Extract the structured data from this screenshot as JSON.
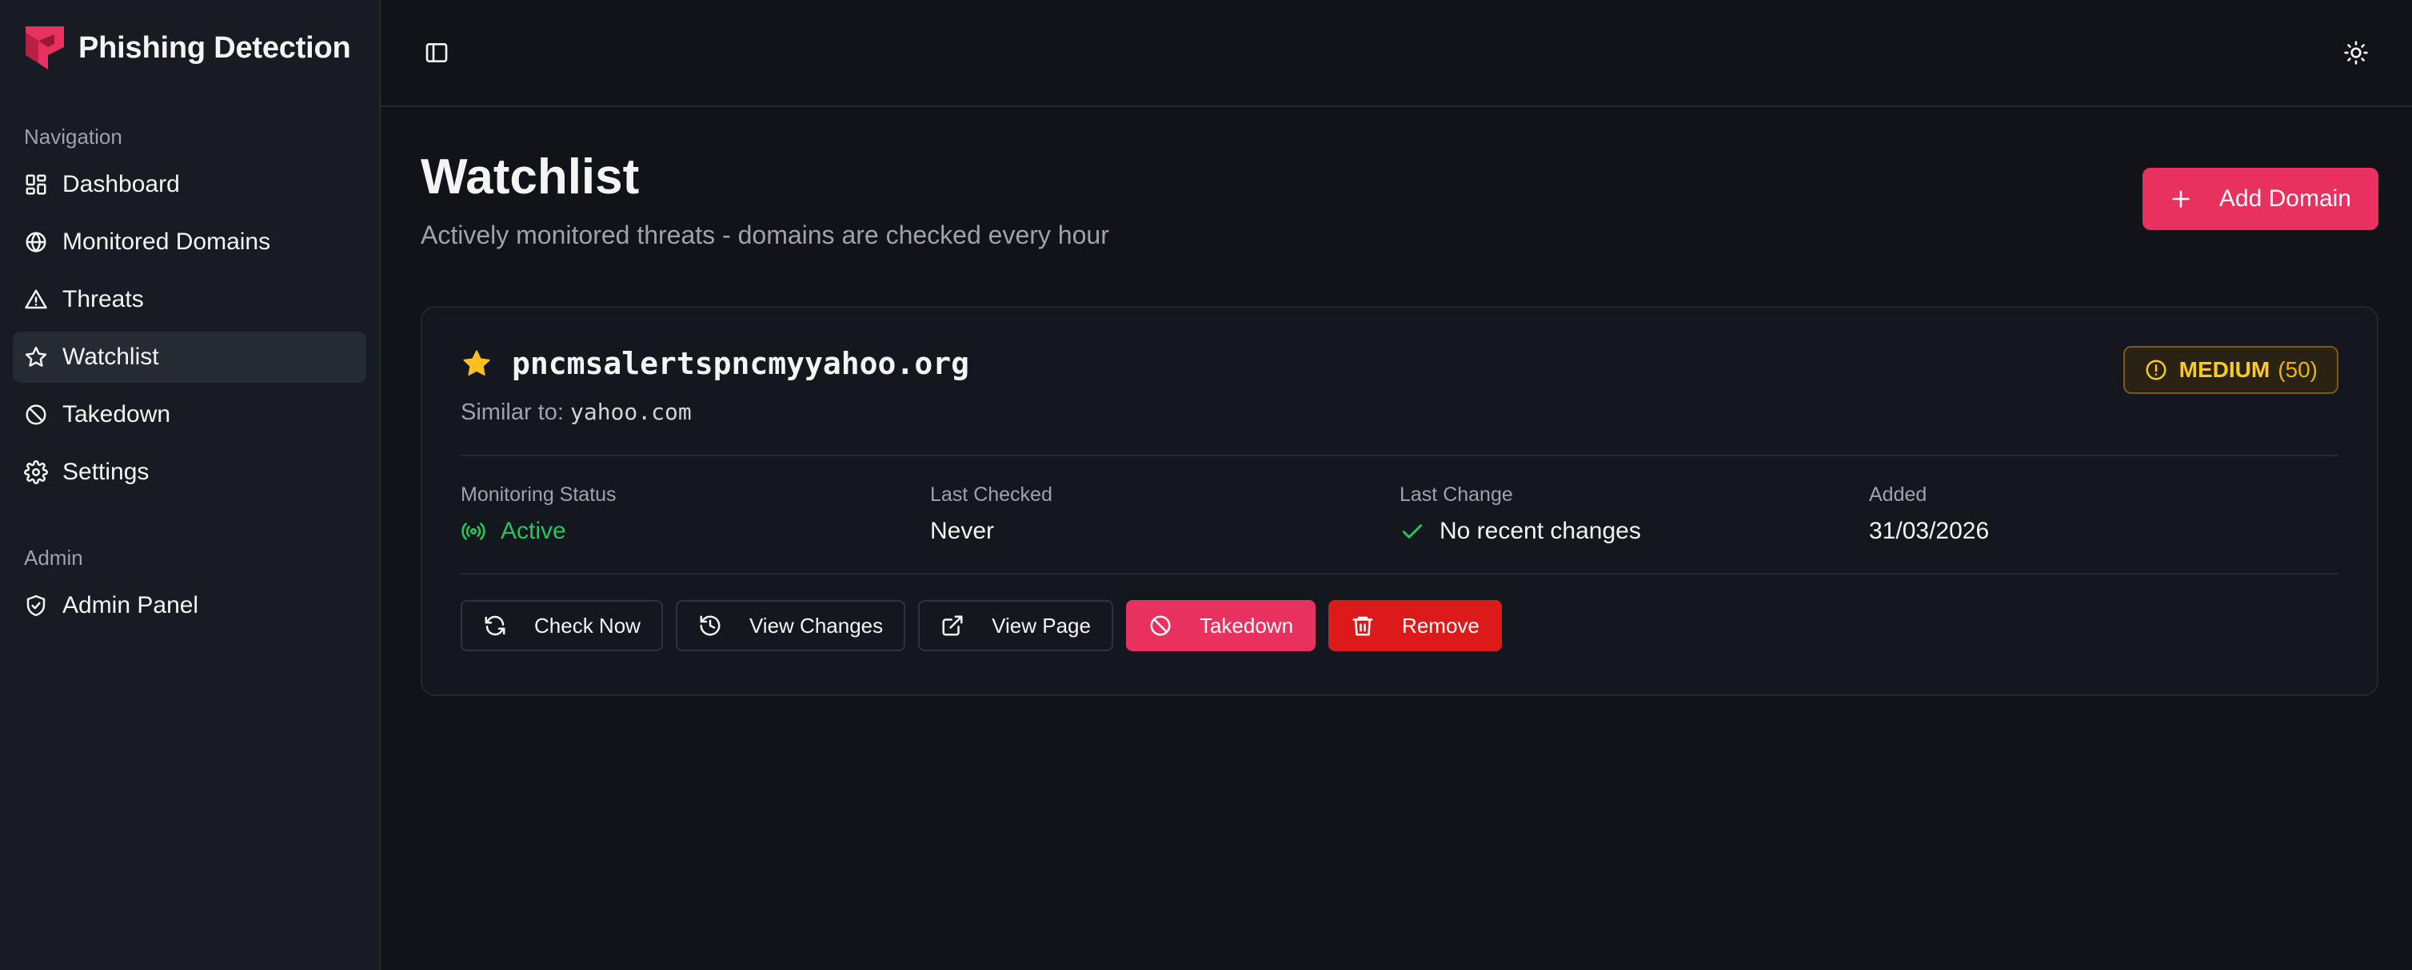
{
  "app": {
    "title": "Phishing Detection"
  },
  "sidebar": {
    "nav_label": "Navigation",
    "items": [
      {
        "label": "Dashboard",
        "icon": "dashboard-icon"
      },
      {
        "label": "Monitored Domains",
        "icon": "globe-icon"
      },
      {
        "label": "Threats",
        "icon": "alert-triangle-icon"
      },
      {
        "label": "Watchlist",
        "icon": "star-icon",
        "active": true
      },
      {
        "label": "Takedown",
        "icon": "ban-icon"
      },
      {
        "label": "Settings",
        "icon": "gear-icon"
      }
    ],
    "admin_label": "Admin",
    "admin_items": [
      {
        "label": "Admin Panel",
        "icon": "shield-check-icon"
      }
    ]
  },
  "page": {
    "title": "Watchlist",
    "subtitle": "Actively monitored threats - domains are checked every hour",
    "add_button": "Add Domain"
  },
  "watch_item": {
    "domain": "pncmsalertspncmyyahoo.org",
    "similar_prefix": "Similar to:",
    "similar_domain": "yahoo.com",
    "severity": "MEDIUM",
    "score": "(50)",
    "stats": {
      "monitoring_status_label": "Monitoring Status",
      "monitoring_status": "Active",
      "last_checked_label": "Last Checked",
      "last_checked": "Never",
      "last_change_label": "Last Change",
      "last_change": "No recent changes",
      "added_label": "Added",
      "added": "31/03/2026"
    },
    "actions": {
      "check_now": "Check Now",
      "view_changes": "View Changes",
      "view_page": "View Page",
      "takedown": "Takedown",
      "remove": "Remove"
    }
  },
  "colors": {
    "accent": "#e8315f",
    "danger": "#dc1a1a",
    "success": "#22c55e",
    "warning": "#facc15",
    "background": "#111318",
    "sidebar": "#181b22"
  }
}
